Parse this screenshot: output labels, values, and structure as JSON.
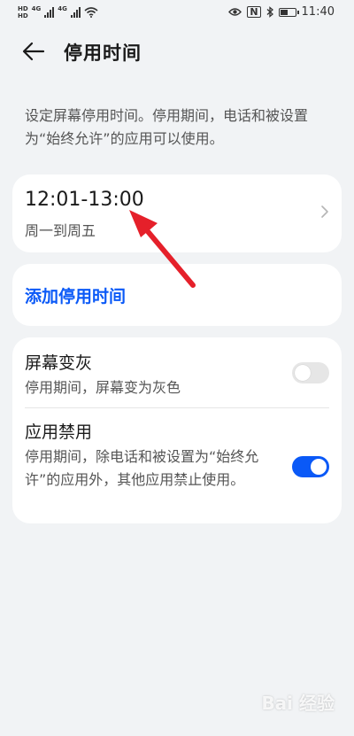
{
  "status_bar": {
    "sim1_label": "HD",
    "sim2_label": "HD",
    "net1": "4G",
    "net2": "4G",
    "nfc": "N",
    "time": "11:40",
    "battery_level": 0.55
  },
  "header": {
    "title": "停用时间"
  },
  "description": "设定屏幕停用时间。停用期间，电话和被设置为“始终允许”的应用可以使用。",
  "schedule": {
    "time_range": "12:01-13:00",
    "days": "周一到周五"
  },
  "add_button_label": "添加停用时间",
  "settings": {
    "grayscale": {
      "title": "屏幕变灰",
      "subtitle": "停用期间，屏幕变为灰色",
      "enabled": false
    },
    "app_disable": {
      "title": "应用禁用",
      "subtitle": "停用期间，除电话和被设置为“始终允许”的应用外，其他应用禁止使用。",
      "enabled": true
    }
  },
  "colors": {
    "accent": "#0a59f7",
    "background": "#f1f3f5",
    "card": "#ffffff",
    "arrow": "#e5202a"
  },
  "watermark": "Bai 经验"
}
